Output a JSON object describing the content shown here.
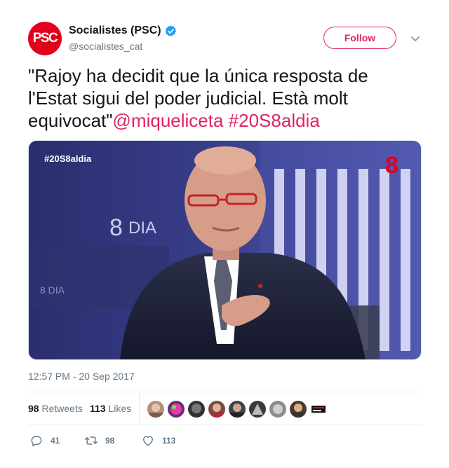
{
  "author": {
    "avatar_text": "PSC",
    "display_name": "Socialistes (PSC)",
    "handle": "@socialistes_cat",
    "verified": true
  },
  "follow_label": "Follow",
  "tweet": {
    "text": "\"Rajoy ha decidit que la única resposta de l'Estat sigui del poder judicial. Està molt equivocat\"",
    "mention": "@miqueliceta",
    "hashtag": "#20S8aldia"
  },
  "media": {
    "hashtag_overlay": "#20S8aldia",
    "studio_logo": "8",
    "studio_logo_sub": "DIA",
    "studio_logo_small": "8 DIA",
    "channel_mark": "8"
  },
  "timestamp": "12:57 PM - 20 Sep 2017",
  "stats": {
    "retweets_count": "98",
    "retweets_label": "Retweets",
    "likes_count": "113",
    "likes_label": "Likes",
    "liker_icons": [
      "avatar-1-icon",
      "avatar-2-icon",
      "avatar-3-icon",
      "avatar-4-icon",
      "avatar-5-icon",
      "avatar-6-icon",
      "avatar-7-icon",
      "avatar-8-icon",
      "avatar-9-icon"
    ]
  },
  "actions": {
    "replies": "41",
    "retweets": "98",
    "likes": "113"
  },
  "colors": {
    "accent": "#e0245e",
    "verified": "#1da1f2",
    "muted": "#657786",
    "psc_red": "#e2001a"
  }
}
